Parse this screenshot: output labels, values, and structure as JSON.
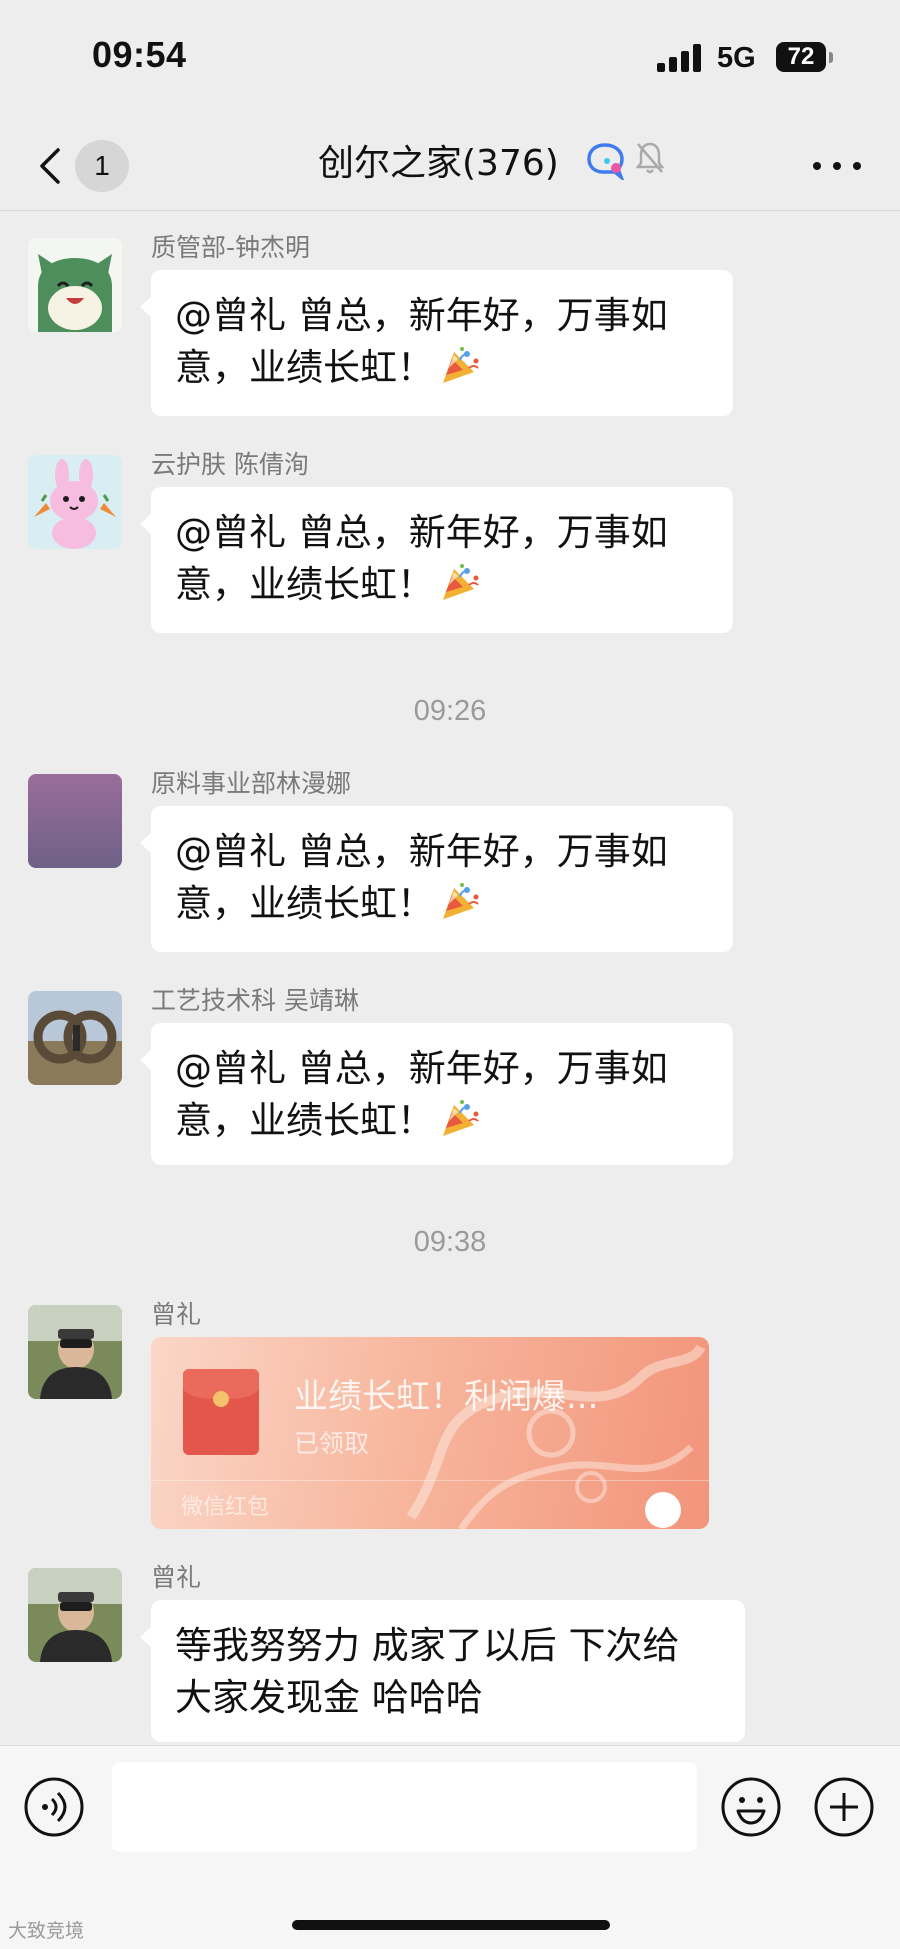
{
  "status_bar": {
    "time": "09:54",
    "network": "5G",
    "battery": "72"
  },
  "nav": {
    "unread_count": "1",
    "title": "创尔之家(376)"
  },
  "messages": [
    {
      "sender": "质管部-钟杰明",
      "text": "@曾礼 曾总，新年好，万事如意，业绩长虹！",
      "line1": "@曾礼 曾总，新年好，万事如",
      "line2": "意，业绩长虹！",
      "emoji": "party-popper"
    },
    {
      "sender": "云护肤 陈倩洵",
      "text": "@曾礼 曾总，新年好，万事如意，业绩长虹！",
      "line1": "@曾礼 曾总，新年好，万事如",
      "line2": "意，业绩长虹！",
      "emoji": "party-popper"
    },
    {
      "sender": "原料事业部林漫娜",
      "text": "@曾礼 曾总，新年好，万事如意，业绩长虹！",
      "line1": "@曾礼 曾总，新年好，万事如",
      "line2": "意，业绩长虹！",
      "emoji": "party-popper"
    },
    {
      "sender": "工艺技术科 吴靖琳",
      "text": "@曾礼 曾总，新年好，万事如意，业绩长虹！",
      "line1": "@曾礼 曾总，新年好，万事如",
      "line2": "意，业绩长虹！",
      "emoji": "party-popper"
    },
    {
      "sender": "曾礼",
      "type": "red_packet",
      "red_packet": {
        "title": "业绩长虹！利润爆...",
        "status": "已领取",
        "footer": "微信红包"
      }
    },
    {
      "sender": "曾礼",
      "text": "等我努努力 成家了以后 下次给大家发现金 哈哈哈",
      "line1": "等我努努力 成家了以后 下次给",
      "line2": "大家发现金 哈哈哈"
    }
  ],
  "time_dividers": [
    "09:26",
    "09:38"
  ],
  "input_bar": {
    "value": "",
    "placeholder": ""
  },
  "watermark": "大致竞境",
  "colors": {
    "background": "#ededed",
    "bubble": "#ffffff",
    "red_packet": "#f7b79e",
    "sender_name": "#7a7a7a",
    "timestamp": "#9a9a9a"
  },
  "icons": [
    "back-chevron-icon",
    "ai-chat-icon",
    "mute-bell-icon",
    "more-icon",
    "party-popper-icon",
    "voice-icon",
    "emoji-icon",
    "plus-icon",
    "red-envelope-icon"
  ]
}
